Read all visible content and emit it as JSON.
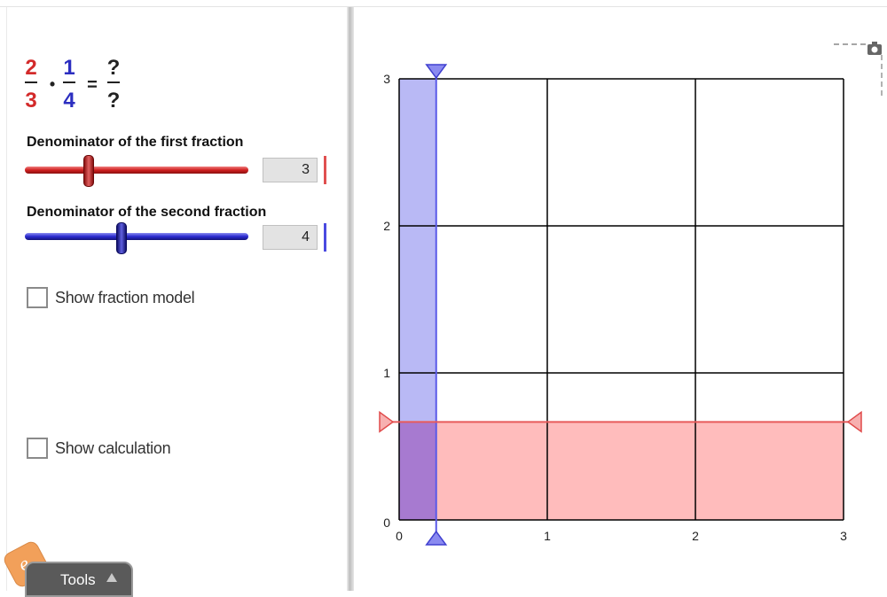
{
  "equation": {
    "f1_num": "2",
    "f1_den": "3",
    "dot": "•",
    "f2_num": "1",
    "f2_den": "4",
    "equals": "=",
    "res_num": "?",
    "res_den": "?"
  },
  "sliders": [
    {
      "label": "Denominator of the first fraction",
      "value": "3"
    },
    {
      "label": "Denominator of the second fraction",
      "value": "4"
    }
  ],
  "checkboxes": [
    {
      "label": "Show fraction model",
      "checked": false
    },
    {
      "label": "Show calculation",
      "checked": false
    }
  ],
  "tools": {
    "label": "Tools"
  },
  "graph": {
    "x_ticks": [
      "0",
      "1",
      "2",
      "3"
    ],
    "y_ticks": [
      "0",
      "1",
      "2",
      "3"
    ],
    "vertical_line_x": 0.25,
    "horizontal_line_y": 0.6667,
    "colors": {
      "red": "#d32a2a",
      "blue": "#2c2ec0",
      "red_fill": "#ffbcbc",
      "blue_fill": "#b9b9f5"
    }
  },
  "icons": [
    "camera-icon",
    "tools-arrow-icon",
    "gizmo-logo-icon"
  ]
}
